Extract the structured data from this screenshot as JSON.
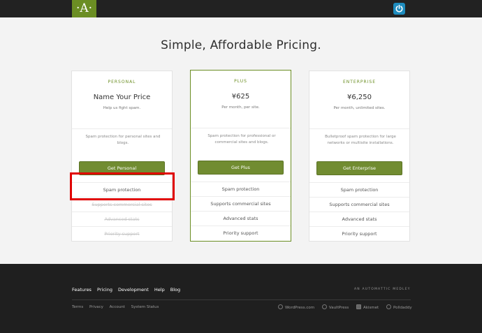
{
  "header": {
    "logo_text": "·A·",
    "power_icon": "power-icon"
  },
  "main": {
    "title": "Simple, Affordable Pricing."
  },
  "plans": [
    {
      "tier": "PERSONAL",
      "price": "Name Your Price",
      "price_sub": "Help us fight spam.",
      "description": "Spam protection for personal sites and blogs.",
      "cta": "Get Personal",
      "features": [
        "Spam protection",
        "Supports commercial sites",
        "Advanced stats",
        "Priority support"
      ],
      "features_enabled": [
        true,
        false,
        false,
        false
      ]
    },
    {
      "tier": "PLUS",
      "price": "¥625",
      "price_sub": "Per month, per site.",
      "description": "Spam protection for professional or commercial sites and blogs.",
      "cta": "Get Plus",
      "features": [
        "Spam protection",
        "Supports commercial sites",
        "Advanced stats",
        "Priority support"
      ],
      "features_enabled": [
        true,
        true,
        true,
        true
      ]
    },
    {
      "tier": "ENTERPRISE",
      "price": "¥6,250",
      "price_sub": "Per month, unlimited sites.",
      "description": "Bulletproof spam protection for large networks or multisite installations.",
      "cta": "Get Enterprise",
      "features": [
        "Spam protection",
        "Supports commercial sites",
        "Advanced stats",
        "Priority support"
      ],
      "features_enabled": [
        true,
        true,
        true,
        true
      ]
    }
  ],
  "footer": {
    "nav": [
      "Features",
      "Pricing",
      "Development",
      "Help",
      "Blog"
    ],
    "tagline": "AN AUTOMATTIC MEDLEY",
    "sub": [
      "Terms",
      "Privacy",
      "Account",
      "System Status"
    ],
    "partners": [
      "WordPress.com",
      "VaultPress",
      "Akismet",
      "Polldaddy"
    ]
  },
  "colors": {
    "accent": "#6b8e23",
    "topbar": "#222222",
    "footer": "#1f1f1f",
    "highlight": "#e00000"
  }
}
